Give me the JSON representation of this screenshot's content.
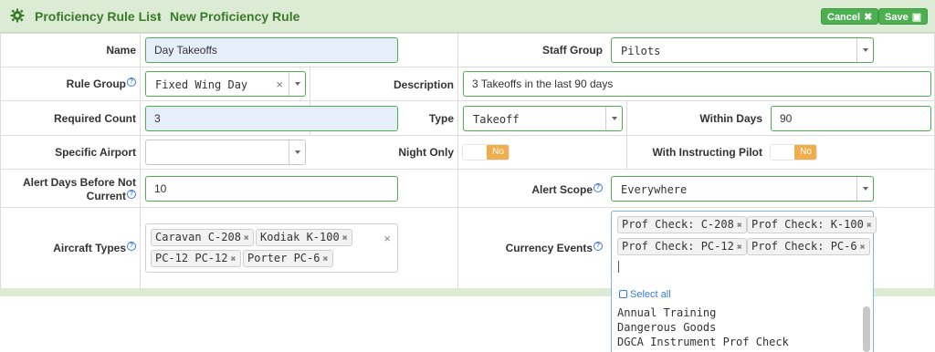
{
  "header": {
    "breadcrumb_root": "Proficiency Rule List",
    "separator": "›",
    "breadcrumb_current": "New Proficiency Rule",
    "cancel_label": "Cancel",
    "save_label": "Save",
    "gear_icon": "gear-icon"
  },
  "form": {
    "name_label": "Name",
    "name_value": "Day Takeoffs",
    "staff_group_label": "Staff Group",
    "staff_group_value": "Pilots",
    "rule_group_label": "Rule Group",
    "rule_group_value": "Fixed Wing Day",
    "description_label": "Description",
    "description_value": "3 Takeoffs in the last 90 days",
    "required_count_label": "Required Count",
    "required_count_value": "3",
    "type_label": "Type",
    "type_value": "Takeoff",
    "within_days_label": "Within Days",
    "within_days_value": "90",
    "specific_airport_label": "Specific Airport",
    "specific_airport_value": "",
    "night_only_label": "Night Only",
    "night_only_value": "No",
    "with_instructing_pilot_label": "With Instructing Pilot",
    "with_instructing_pilot_value": "No",
    "alert_days_label_line1": "Alert Days Before Not",
    "alert_days_label_line2": "Current",
    "alert_days_value": "10",
    "alert_scope_label": "Alert Scope",
    "alert_scope_value": "Everywhere",
    "aircraft_types_label": "Aircraft Types",
    "aircraft_types": [
      "Caravan C-208",
      "Kodiak K-100",
      "PC-12 PC-12",
      "Porter PC-6"
    ],
    "currency_events_label": "Currency Events",
    "currency_events": [
      "Prof Check: C-208",
      "Prof Check: K-100",
      "Prof Check: PC-12",
      "Prof Check: PC-6"
    ]
  },
  "dropdown": {
    "select_all": "Select all",
    "options": [
      "Annual Training",
      "Dangerous Goods",
      "DGCA Instrument Prof Check"
    ]
  },
  "colors": {
    "accent": "#4caf50",
    "header_bg": "#dcebd4",
    "toggle_no": "#f0ad4e",
    "link": "#3a7bd5"
  }
}
